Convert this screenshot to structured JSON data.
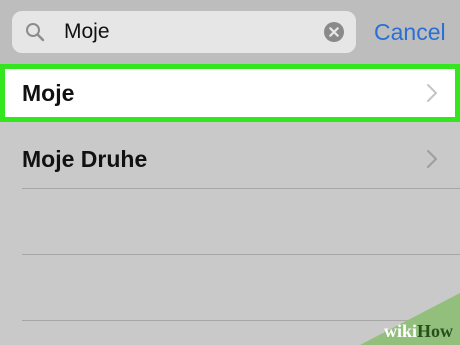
{
  "search": {
    "query": "Moje",
    "cancel_label": "Cancel"
  },
  "results": [
    {
      "label": "Moje"
    },
    {
      "label": "Moje Druhe"
    }
  ],
  "watermark": {
    "wiki": "wiki",
    "how": "How"
  },
  "icons": {
    "search": "magnifying-glass",
    "clear": "x-circle",
    "disclosure": "chevron-right"
  },
  "colors": {
    "highlight_outline": "#34e61e",
    "accent": "#2a6fd6"
  }
}
